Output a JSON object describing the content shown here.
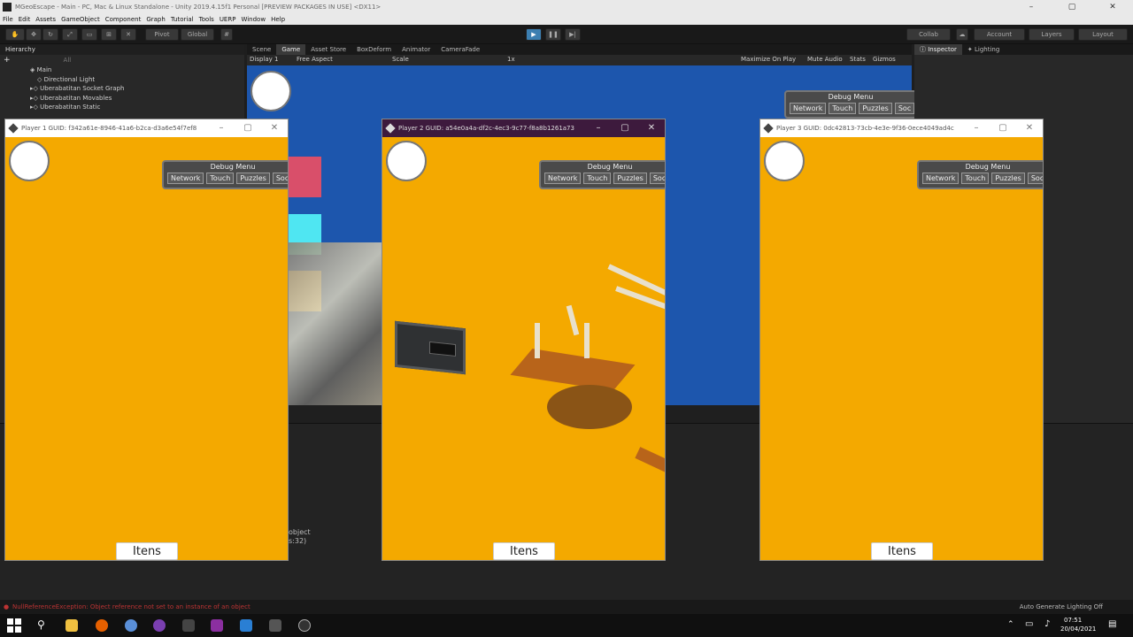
{
  "unity": {
    "window_title": "MGeoEscape - Main - PC, Mac & Linux Standalone - Unity 2019.4.15f1 Personal [PREVIEW PACKAGES IN USE] <DX11>",
    "menu": [
      "File",
      "Edit",
      "Assets",
      "GameObject",
      "Component",
      "Graph",
      "Tutorial",
      "Tools",
      "UERP",
      "Window",
      "Help"
    ],
    "toolbar": {
      "pivot": "Pivot",
      "global": "Global",
      "collab": "Collab",
      "account": "Account",
      "layers": "Layers",
      "layout": "Layout"
    },
    "hierarchy": {
      "tab": "Hierarchy",
      "search_placeholder": "All",
      "scene": "Main",
      "items": [
        "Directional Light",
        "Uberabatitan Socket Graph",
        "Uberabatitan Movables",
        "Uberabatitan Static"
      ]
    },
    "gameview": {
      "tabs": [
        "Scene",
        "Game",
        "Asset Store",
        "BoxDeform",
        "Animator",
        "CameraFade"
      ],
      "active_tab": "Game",
      "display": "Display 1",
      "aspect": "Free Aspect",
      "scale_label": "Scale",
      "scale_value": "1x",
      "options": [
        "Maximize On Play",
        "Mute Audio",
        "Stats",
        "Gizmos"
      ],
      "debug_menu": {
        "title": "Debug Menu",
        "buttons": [
          "Network",
          "Touch",
          "Puzzles",
          "Soc"
        ]
      }
    },
    "inspector": {
      "tabs": [
        "Inspector",
        "Lighting"
      ]
    },
    "console": {
      "partial_text_1": "object",
      "partial_text_2": "s:32)"
    },
    "status": {
      "error": "NullReferenceException: Object reference not set to an instance of an object",
      "right": "Auto Generate Lighting Off"
    }
  },
  "players": [
    {
      "title": "Player 1 GUID: f342a61e-8946-41a6-b2ca-d3a6e54f7ef8",
      "debug_title": "Debug Menu",
      "debug_buttons": [
        "Network",
        "Touch",
        "Puzzles",
        "Soc"
      ],
      "items_button": "Itens"
    },
    {
      "title": "Player 2 GUID: a54e0a4a-df2c-4ec3-9c77-f8a8b1261a73",
      "debug_title": "Debug Menu",
      "debug_buttons": [
        "Network",
        "Touch",
        "Puzzles",
        "Soc"
      ],
      "items_button": "Itens"
    },
    {
      "title": "Player 3 GUID: 0dc42813-73cb-4e3e-9f36-0ece4049ad4c",
      "debug_title": "Debug Menu",
      "debug_buttons": [
        "Network",
        "Touch",
        "Puzzles",
        "Soc"
      ],
      "items_button": "Itens"
    }
  ],
  "taskbar": {
    "time": "07:51",
    "date": "20/04/2021"
  },
  "colors": {
    "game_background": "#f4a900",
    "scene_blue": "#1d56ad"
  }
}
